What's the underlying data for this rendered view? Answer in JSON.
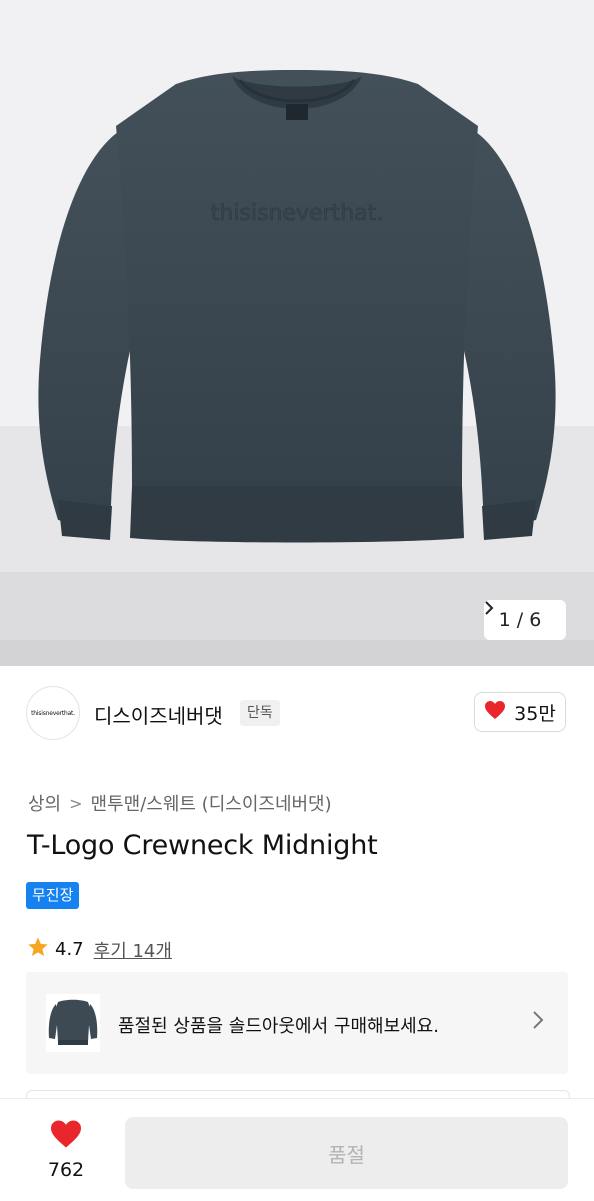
{
  "hero": {
    "pager_label": "1 / 6",
    "pager_icon": "chevron-right-icon",
    "garment_text": "thisisneverthat."
  },
  "brand": {
    "logo_text": "thisisneverthat.",
    "name": "디스이즈네버댓",
    "badge": "단독",
    "likes": "35만"
  },
  "breadcrumb": {
    "level1": "상의",
    "separator": ">",
    "level2": "맨투맨/스웨트 (디스이즈네버댓)"
  },
  "product": {
    "title": "T-Logo Crewneck Midnight",
    "delivery_badge": "무진장",
    "rating": "4.7",
    "reviews": "후기 14개"
  },
  "soldout_banner": {
    "text": "품절된 상품을 솔드아웃에서 구매해보세요.",
    "chevron": "›"
  },
  "bottom_bar": {
    "wish_count": "762",
    "buy_label": "품절"
  },
  "colors": {
    "accent_blue": "#1682f2",
    "heart_red": "#e8262b",
    "star": "#f5a623",
    "garment": "#3d4a54"
  }
}
